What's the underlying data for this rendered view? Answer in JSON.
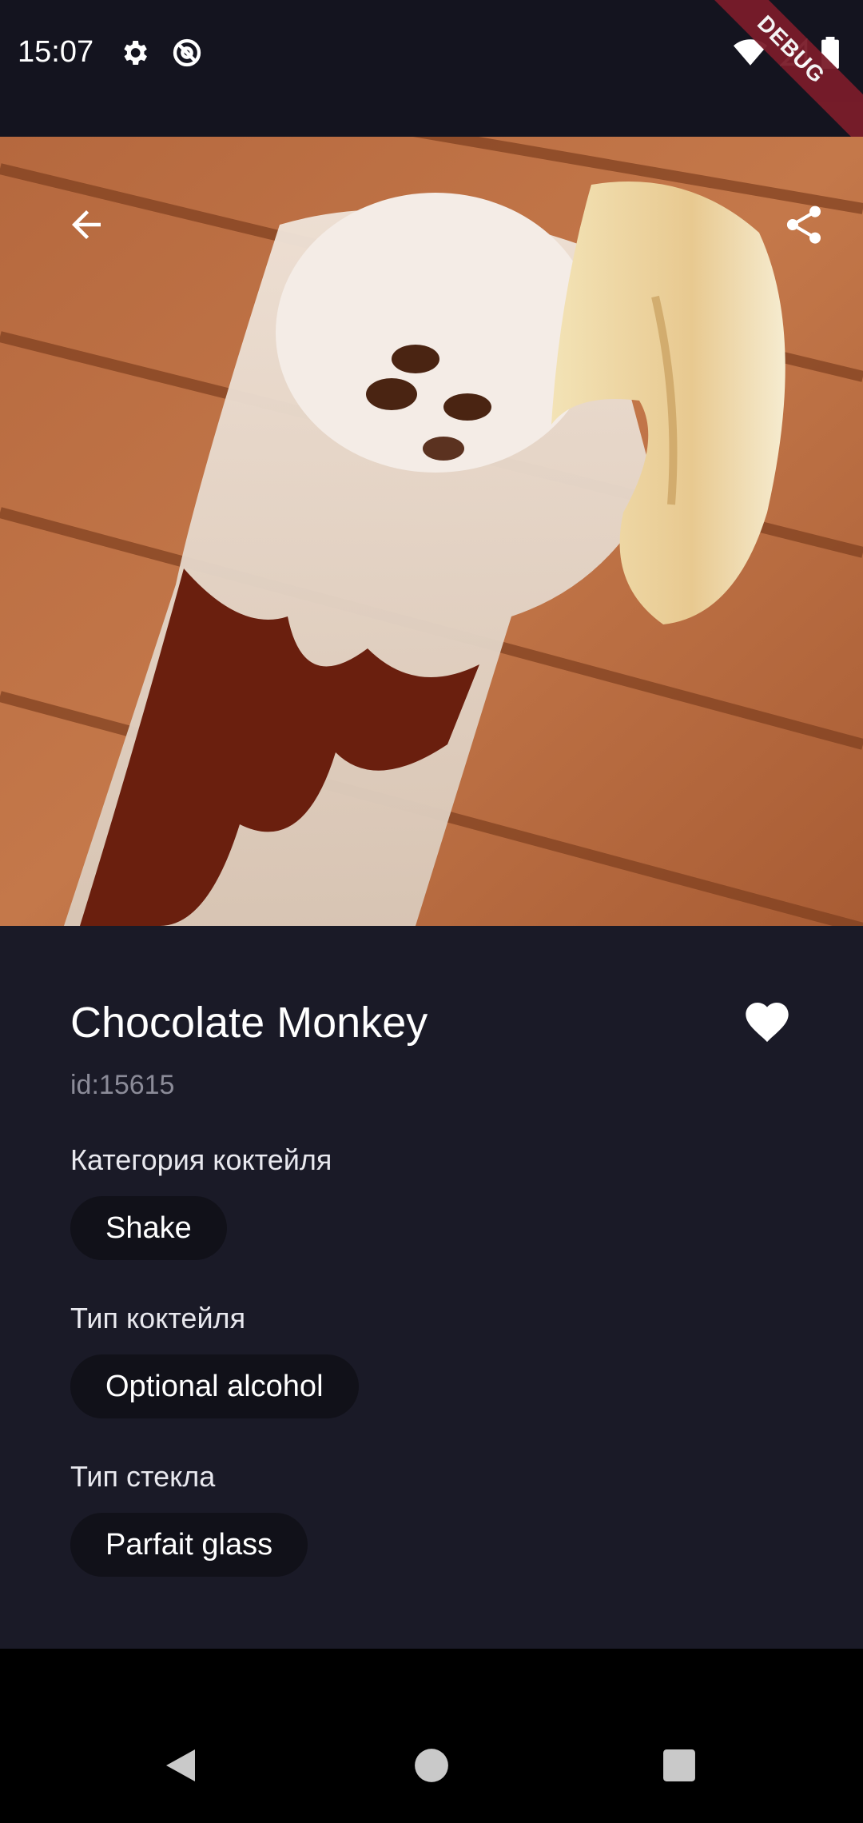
{
  "status_bar": {
    "time": "15:07",
    "icons_left": [
      "gear-icon",
      "at-sign-icon"
    ],
    "icons_right": [
      "wifi-icon",
      "signal-icon",
      "battery-icon"
    ],
    "debug_label": "DEBUG"
  },
  "hero": {
    "image_description_icon": "cocktail-photo",
    "back_icon": "arrow-left-icon",
    "share_icon": "share-icon"
  },
  "cocktail": {
    "name": "Chocolate Monkey",
    "id_text": "id:15615",
    "favorite_icon": "heart-icon",
    "category_label": "Категория коктейля",
    "category_value": "Shake",
    "type_label": "Тип коктейля",
    "type_value": "Optional alcohol",
    "glass_label": "Тип стекла",
    "glass_value": "Parfait glass"
  },
  "nav_bar": {
    "buttons": [
      "back-triangle-icon",
      "home-circle-icon",
      "recents-square-icon"
    ]
  },
  "colors": {
    "background": "#1a1a27",
    "status_bar": "#14141f",
    "chip_bg": "#111119",
    "muted_text": "#8b8b98",
    "debug_banner": "#7a1c2a"
  }
}
